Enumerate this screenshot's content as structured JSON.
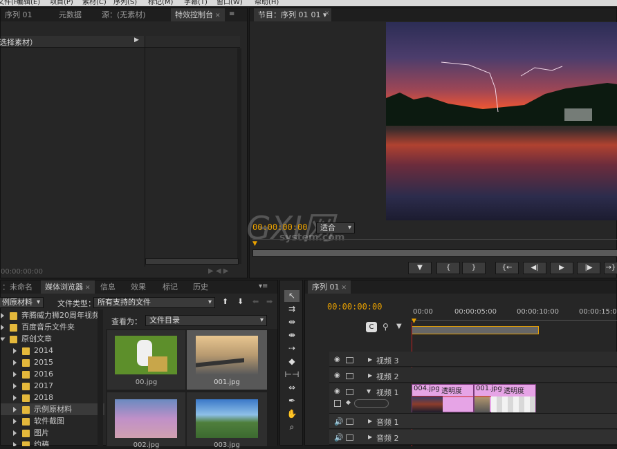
{
  "menu": [
    "文件(F)",
    "编辑(E)",
    "项目(P)",
    "素材(C)",
    "序列(S)",
    "标记(M)",
    "字幕(T)",
    "窗口(W)",
    "帮助(H)"
  ],
  "source_panel": {
    "tabs": [
      "序列 01",
      "元数据",
      "源：(无素材)",
      "特效控制台"
    ],
    "header": "选择素材）",
    "timecode": "00:00:00:00"
  },
  "program": {
    "tab": "节目：序列 01",
    "timecode": "00:00:00:00",
    "zoom": "适合",
    "transport": [
      "▼",
      "{",
      "}",
      "{←",
      "◀|",
      "▶",
      "|▶",
      "→}"
    ]
  },
  "project_panel": {
    "tabs": [
      "：未命名",
      "媒体浏览器",
      "信息",
      "效果",
      "标记",
      "历史"
    ],
    "location": "例原材料",
    "file_type_label": "文件类型：",
    "file_type_value": "所有支持的文件",
    "view_as_label": "查看为：",
    "view_as_value": "文件目录",
    "tree": [
      {
        "label": "奔腾威力狮20周年视频",
        "level": 1
      },
      {
        "label": "百度音乐文件夹",
        "level": 1
      },
      {
        "label": "原创文章",
        "level": 1
      },
      {
        "label": "2014",
        "level": 2
      },
      {
        "label": "2015",
        "level": 2
      },
      {
        "label": "2016",
        "level": 2
      },
      {
        "label": "2017",
        "level": 2
      },
      {
        "label": "2018",
        "level": 2
      },
      {
        "label": "示例原材料",
        "level": 2
      },
      {
        "label": "软件截图",
        "level": 2
      },
      {
        "label": "图片",
        "level": 2
      },
      {
        "label": "约稿",
        "level": 2
      }
    ],
    "thumbnails": [
      {
        "name": "00.jpg",
        "bg": "#5d8f2b"
      },
      {
        "name": "001.jpg",
        "bg": "#8a7a5a"
      },
      {
        "name": "002.jpg",
        "bg": "#7a7aa8"
      },
      {
        "name": "003.jpg",
        "bg": "#4f7f3c"
      }
    ]
  },
  "timeline": {
    "tab": "序列 01",
    "timecode": "00:00:00:00",
    "ruler": [
      "00:00",
      "00:00:05:00",
      "00:00:10:00",
      "00:00:15:00"
    ],
    "tracks": [
      {
        "name": "视频 3"
      },
      {
        "name": "视频 2"
      },
      {
        "name": "视频 1"
      },
      {
        "name": "音频 1"
      },
      {
        "name": "音频 2"
      }
    ],
    "clips": [
      {
        "name": "004.jpg",
        "fx": "透明度"
      },
      {
        "name": "001.jpg",
        "fx": "透明度"
      }
    ]
  },
  "watermark": {
    "brand": "GXI网",
    "domain": "system.com"
  }
}
